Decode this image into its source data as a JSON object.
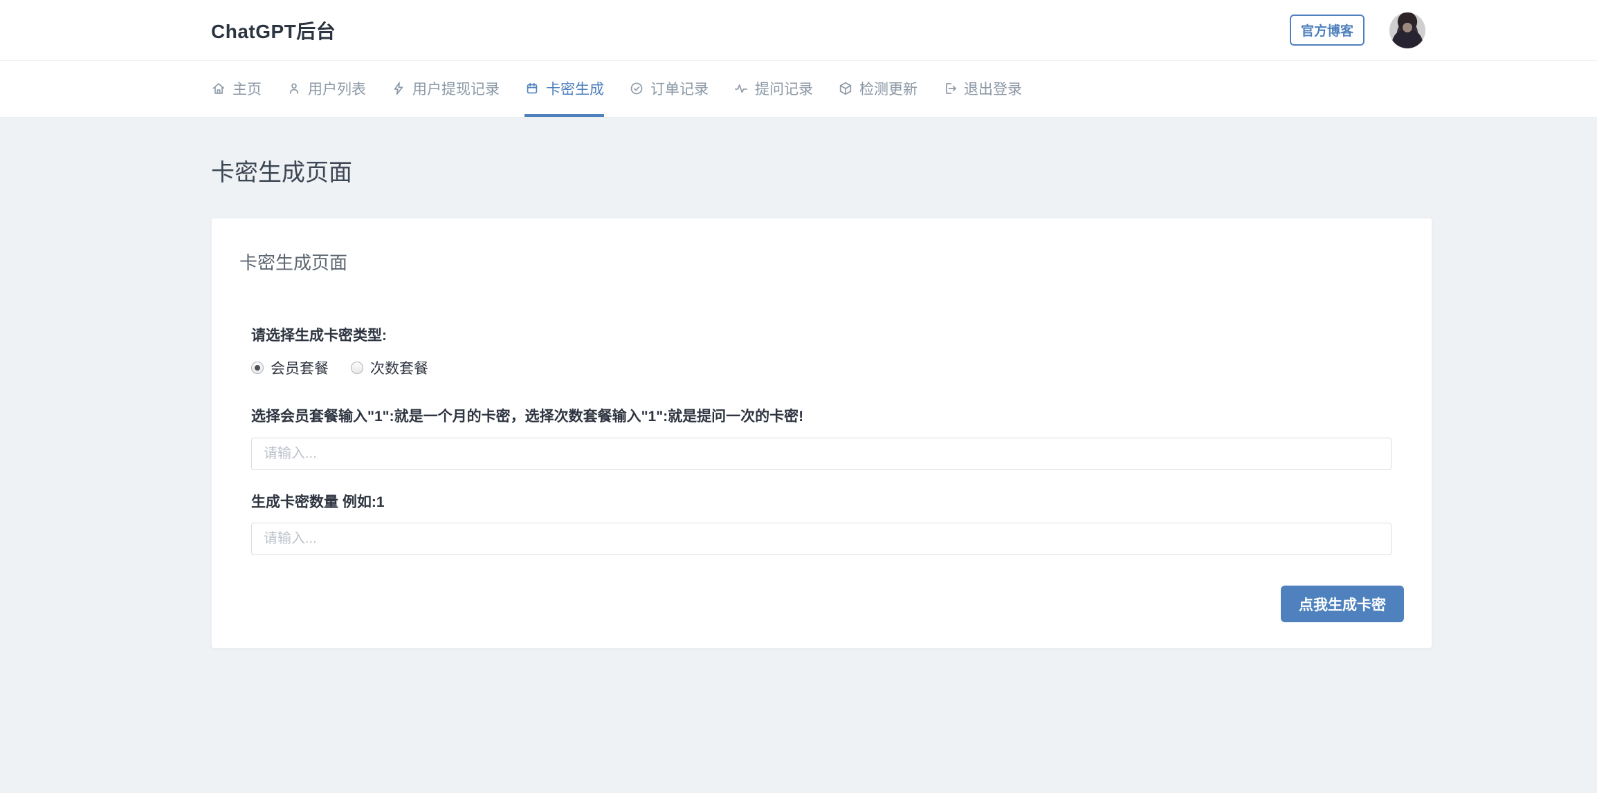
{
  "header": {
    "title": "ChatGPT后台",
    "blog_button_label": "官方博客"
  },
  "nav": {
    "items": [
      {
        "label": "主页",
        "icon": "home-icon",
        "active": false
      },
      {
        "label": "用户列表",
        "icon": "user-icon",
        "active": false
      },
      {
        "label": "用户提现记录",
        "icon": "lightning-icon",
        "active": false
      },
      {
        "label": "卡密生成",
        "icon": "calendar-icon",
        "active": true
      },
      {
        "label": "订单记录",
        "icon": "check-circle-icon",
        "active": false
      },
      {
        "label": "提问记录",
        "icon": "pulse-icon",
        "active": false
      },
      {
        "label": "检测更新",
        "icon": "package-icon",
        "active": false
      },
      {
        "label": "退出登录",
        "icon": "logout-icon",
        "active": false
      }
    ]
  },
  "page": {
    "title": "卡密生成页面"
  },
  "card": {
    "heading": "卡密生成页面",
    "type_label": "请选择生成卡密类型:",
    "radio_options": [
      {
        "label": "会员套餐",
        "checked": true
      },
      {
        "label": "次数套餐",
        "checked": false
      }
    ],
    "value_label": "选择会员套餐输入\"1\":就是一个月的卡密，选择次数套餐输入\"1\":就是提问一次的卡密!",
    "value_placeholder": "请输入...",
    "count_label": "生成卡密数量 例如:1",
    "count_placeholder": "请输入...",
    "submit_label": "点我生成卡密"
  },
  "colors": {
    "accent": "#4e81bd",
    "background": "#eff2f5",
    "nav_inactive": "#8b98a5"
  }
}
